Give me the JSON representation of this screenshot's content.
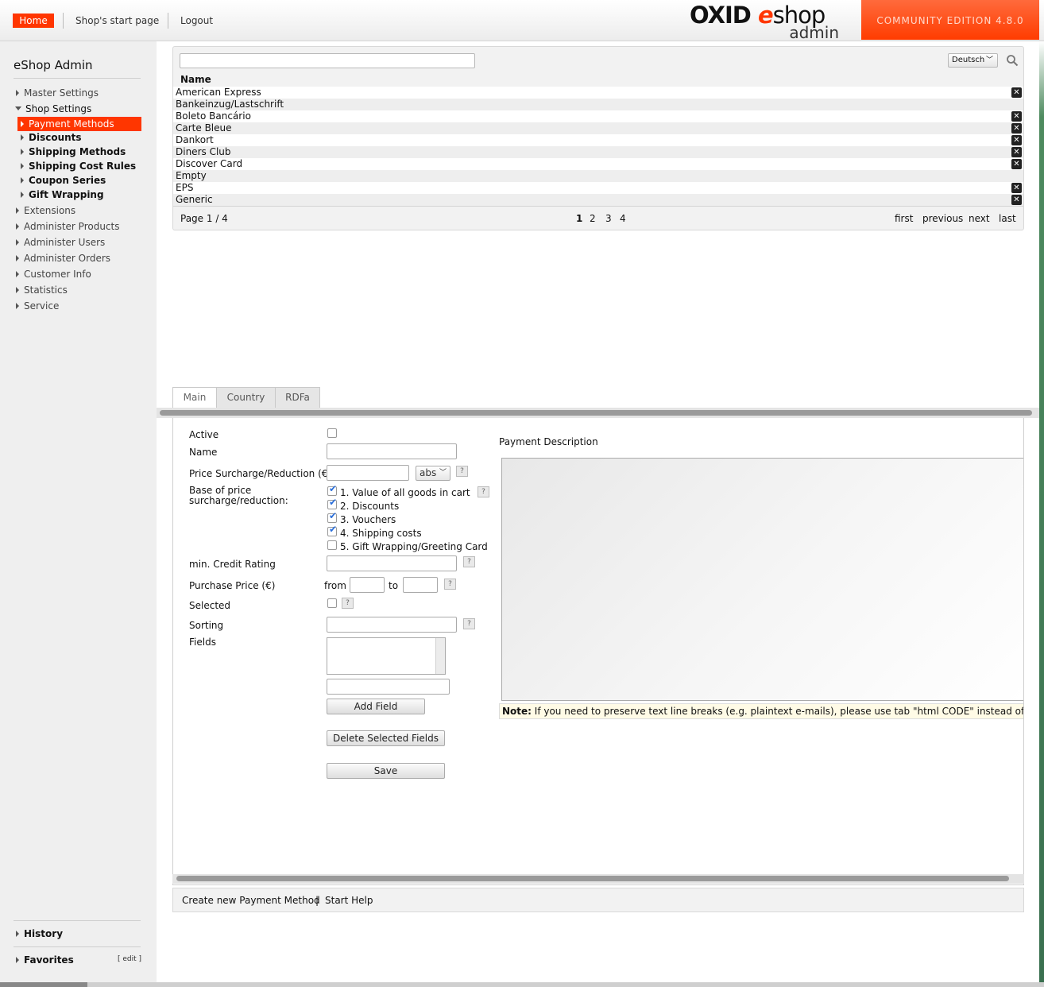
{
  "header": {
    "home": "Home",
    "start_page": "Shop's start page",
    "logout": "Logout",
    "logo_oxid": "OXID",
    "logo_e": "e",
    "logo_shop": "shop",
    "logo_admin": "admin",
    "edition": "COMMUNITY EDITION 4.8.0",
    "brand_color": "#ff3600"
  },
  "sidebar": {
    "title": "eShop Admin",
    "items": [
      {
        "label": "Master Settings"
      },
      {
        "label": "Shop Settings"
      },
      {
        "label": "Payment Methods"
      },
      {
        "label": "Discounts"
      },
      {
        "label": "Shipping Methods"
      },
      {
        "label": "Shipping Cost Rules"
      },
      {
        "label": "Coupon Series"
      },
      {
        "label": "Gift Wrapping"
      },
      {
        "label": "Extensions"
      },
      {
        "label": "Administer Products"
      },
      {
        "label": "Administer Users"
      },
      {
        "label": "Administer Orders"
      },
      {
        "label": "Customer Info"
      },
      {
        "label": "Statistics"
      },
      {
        "label": "Service"
      }
    ],
    "history": "History",
    "favorites": "Favorites",
    "edit": "[ edit ]"
  },
  "list": {
    "search_value": "",
    "language": "Deutsch",
    "column_name": "Name",
    "rows": [
      {
        "name": "American Express",
        "deletable": true
      },
      {
        "name": "Bankeinzug/Lastschrift",
        "deletable": false
      },
      {
        "name": "Boleto Bancário",
        "deletable": true
      },
      {
        "name": "Carte Bleue",
        "deletable": true
      },
      {
        "name": "Dankort",
        "deletable": true
      },
      {
        "name": "Diners Club",
        "deletable": true
      },
      {
        "name": "Discover Card",
        "deletable": true
      },
      {
        "name": "Empty",
        "deletable": false
      },
      {
        "name": "EPS",
        "deletable": true
      },
      {
        "name": "Generic",
        "deletable": true
      }
    ],
    "pager": {
      "info": "Page 1 / 4",
      "pages": [
        "1",
        "2",
        "3",
        "4"
      ],
      "current": "1",
      "first": "first",
      "previous": "previous",
      "next": "next",
      "last": "last"
    }
  },
  "tabs": [
    {
      "label": "Main",
      "active": true
    },
    {
      "label": "Country",
      "active": false
    },
    {
      "label": "RDFa",
      "active": false
    }
  ],
  "form": {
    "active_label": "Active",
    "name_label": "Name",
    "surcharge_label": "Price Surcharge/Reduction (€)",
    "surcharge_type": "abs",
    "base_label_1": "Base of price",
    "base_label_2": "surcharge/reduction:",
    "base_options": [
      {
        "label": "1. Value of all goods in cart",
        "checked": true
      },
      {
        "label": "2. Discounts",
        "checked": true
      },
      {
        "label": "3. Vouchers",
        "checked": true
      },
      {
        "label": "4. Shipping costs",
        "checked": true
      },
      {
        "label": "5. Gift Wrapping/Greeting Card",
        "checked": false
      }
    ],
    "credit_label": "min. Credit Rating",
    "purchase_label": "Purchase Price (€)",
    "from_label": "from",
    "to_label": "to",
    "selected_label": "Selected",
    "sorting_label": "Sorting",
    "fields_label": "Fields",
    "add_field": "Add Field",
    "delete_fields": "Delete Selected Fields",
    "save": "Save",
    "help_glyph": "?",
    "description_label": "Payment Description",
    "note_bold": "Note:",
    "note_text": " If you need to preserve text line breaks (e.g. plaintext e-mails), please use tab \"html CODE\" instead of \"Design\"."
  },
  "actions": {
    "create": "Create new Payment Method",
    "separator": "|",
    "help": "Start Help"
  }
}
